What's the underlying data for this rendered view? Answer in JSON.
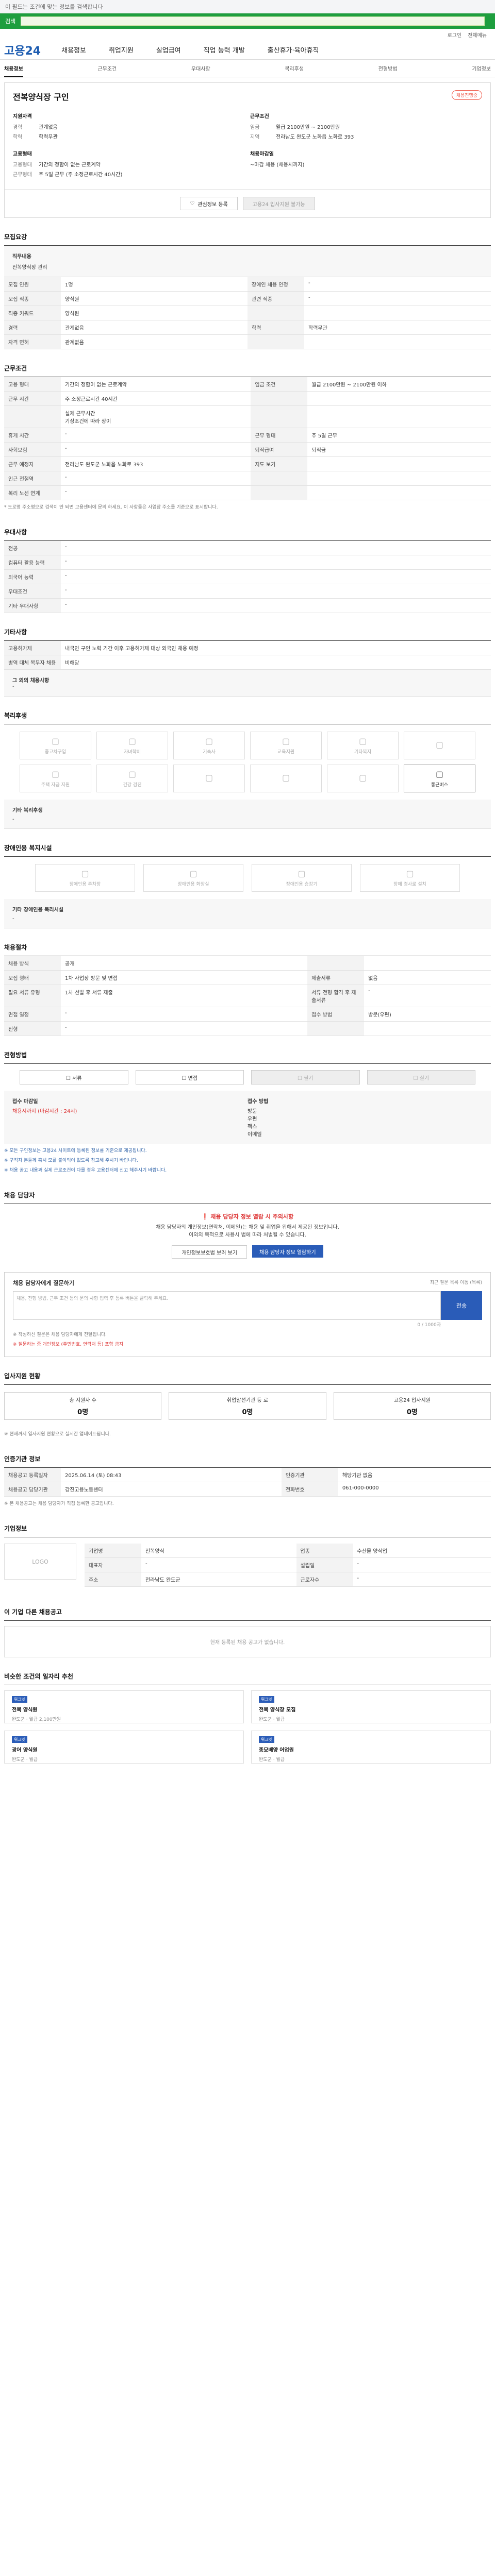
{
  "top": {
    "banner": "이 필드는 조건에 맞는 정보를 검색합니다",
    "search_label": "검색"
  },
  "util": {
    "login": "로그인",
    "sitemap": "전체메뉴"
  },
  "brand": {
    "logo": "고용24"
  },
  "gnb": [
    "채용정보",
    "취업지원",
    "실업급여",
    "직업 능력 개발",
    "출산휴가·육아휴직"
  ],
  "tabs": [
    "채용정보",
    "근무조건",
    "우대사항",
    "복리후생",
    "전형방법",
    "기업정보"
  ],
  "job": {
    "title": "전복양식장 구인",
    "status": "채용진행중",
    "company_h": "지원자격",
    "career_k": "경력",
    "career_v": "관계없음",
    "edu_k": "학력",
    "edu_v": "학력무관",
    "emp_h": "고용형태",
    "type_k": "고용형태",
    "type_v": "기간의 정함이 없는 근로계약",
    "time_k": "근무형태",
    "time_v": "주 5일 근무 (주 소정근로시간 40시간)",
    "cond_h": "근무조건",
    "pay_k": "임금",
    "pay_v": "월급 2100만원 ~ 2100만원",
    "loc_k": "지역",
    "loc_v": "전라남도 완도군 노화읍 노화로 393",
    "proc_h": "채용마감일",
    "proc_v": "~마감 채용 (채용시까지)",
    "save": "관심정보 등록",
    "apply": "고용24 입사지원 불가능"
  },
  "s1": {
    "title": "모집요강",
    "box_t": "직무내용",
    "box_v": "전복양식장 관리",
    "rows": [
      [
        "모집 인원",
        "1명",
        "장애인 채용 인정",
        "-"
      ],
      [
        "모집 직종",
        "양식원",
        "관련 직종",
        "-"
      ],
      [
        "직종 키워드",
        "양식원",
        "",
        ""
      ],
      [
        "경력",
        "관계없음",
        "학력",
        "학력무관"
      ],
      [
        "자격 면허",
        "관계없음",
        "",
        ""
      ]
    ]
  },
  "s2": {
    "title": "근무조건",
    "rows": [
      [
        "고용 형태",
        "기간의 정함이 없는 근로계약",
        "임금 조건",
        "월급 2100만원 ~ 2100만원 이하"
      ],
      [
        "근무 시간",
        "주 소정근로시간 40시간",
        "",
        ""
      ],
      [
        "",
        "실제 근무시간\n기상조건에 따라 상이",
        "",
        ""
      ],
      [
        "휴게 시간",
        "-",
        "근무 형태",
        "주 5일 근무"
      ],
      [
        "사회보험",
        "-",
        "퇴직급여",
        "퇴직금"
      ],
      [
        "근무 예정지",
        "전라남도 완도군 노화읍 노화로 393",
        "지도 보기",
        ""
      ],
      [
        "인근 전철역",
        "-",
        "",
        ""
      ],
      [
        "복리 노선 연계",
        "-",
        "",
        ""
      ]
    ],
    "note": "* 도로명 주소명으로 검색이 안 되면 고용센터에 문의 하세요. 이 사항들은 사업장 주소를 기준으로 표시합니다."
  },
  "s3": {
    "title": "우대사항",
    "rows": [
      [
        "전공",
        "-"
      ],
      [
        "컴퓨터 활용 능력",
        "-"
      ],
      [
        "외국어 능력",
        "-"
      ],
      [
        "우대조건",
        "-"
      ],
      [
        "기타 우대사항",
        "-"
      ]
    ]
  },
  "s4": {
    "title": "기타사항",
    "rows": [
      [
        "고용허가제",
        "내국인 구인 노력 기간 이후 고용허가제 대상 외국인 채용 예정"
      ],
      [
        "병역 대체 복무자 채용",
        "비해당"
      ]
    ],
    "box_t": "그 외의 채용사항",
    "box_v": "-"
  },
  "s5": {
    "title": "복리후생",
    "icons": [
      "중고차구입",
      "자녀학비",
      "기숙사",
      "교육지원",
      "기타복지",
      "",
      "주택 자금 지원",
      "건강 검진",
      "",
      "",
      "",
      "통근버스"
    ],
    "box_t": "기타 복리후생",
    "box_v": "-"
  },
  "s6": {
    "title": "장애인용 복지시설",
    "icons": [
      "장애인용 주차장",
      "장애인용 화장실",
      "장애인용 승강기",
      "장애 경사로 설치"
    ],
    "box_t": "기타 장애인용 복리시설",
    "box_v": "-"
  },
  "s7": {
    "title": "채용절차",
    "rows": [
      [
        "채용 방식",
        "공개",
        "",
        ""
      ],
      [
        "모집 형태",
        "1차 사업장 방문 및 면접",
        "제출서류",
        "없음"
      ],
      [
        "필요 서류 유형",
        "1차 선발 후 서류 제출",
        "서류 전형 합격 후 제출서류",
        "-"
      ],
      [
        "면접 일정",
        "-",
        "접수 방법",
        "방문(우편)"
      ],
      [
        "전형",
        "-",
        "",
        ""
      ]
    ]
  },
  "s8": {
    "title": "전형방법",
    "choices": [
      "서류",
      "면접",
      "필기",
      "실기"
    ],
    "step_l": "접수 마감일",
    "step_l_v": "채용시까지 (마감시간 : 24시)",
    "step_r": "접수 방법",
    "step_r_v": "방문\n우편\n팩스\n이메일",
    "notes": [
      "※ 모든 구인정보는 고용24 사이트에 등록된 정보를 기준으로 제공됩니다.",
      "※ 구직자 분들께 혹시 모를 불이익이 없도록 참고해 주시기 바랍니다.",
      "※ 채용 공고 내용과 실제 근로조건이 다를 경우 고용센터에 신고 해주시기 바랍니다."
    ]
  },
  "s9": {
    "title": "채용 담당자",
    "warn": "채용 담당자 정보 열람 시 주의사항",
    "p": "채용 담당자의 개인정보(연락처, 이메일)는 채용 및 취업을 위해서 제공된 정보입니다.\n이외의 목적으로 사용시 법에 따라 처벌될 수 있습니다.",
    "b1": "개인정보보호법 보러 보기",
    "b2": "채용 담당자 정보 열람하기"
  },
  "s10": {
    "title": "채용 담당자에게 질문하기",
    "hint": "최근 질문 목록 이동 (목록)",
    "placeholder": "채용, 전형 방법, 근무 조건 등의 문의 사항 입력 후 등록 버튼을 클릭해 주세요.",
    "count": "0 / 1000자",
    "send": "전송",
    "n1": "※ 작성하신 질문은 채용 담당자에게 전달됩니다.",
    "n2": "※ 질문하는 중 개인정보 (주민번호, 연락처 등) 포함 금지"
  },
  "s11": {
    "title": "입사지원 현황",
    "s": [
      [
        "총 지원자 수",
        "0명"
      ],
      [
        "취업알선기관 등 로",
        "0명"
      ],
      [
        "고용24 입사지원",
        "0명"
      ]
    ],
    "note": "※ 현재까지 입사지원 현황으로 실시간 업데이트됩니다."
  },
  "s12": {
    "title": "인증기관 정보",
    "rows": [
      [
        "채용공고 등록일자",
        "2025.06.14 (토) 08:43",
        "인증기관",
        "해당기관 없음"
      ],
      [
        "채용공고 담당기관",
        "강진고용노동센터",
        "전화번호",
        "061-000-0000"
      ]
    ],
    "note": "※ 본 채용공고는 채용 담당자가 직접 등록한 공고입니다."
  },
  "s13": {
    "title": "기업정보",
    "company": "전복양식장",
    "logo": "LOGO",
    "rows": [
      [
        "기업명",
        "전복양식",
        "업종",
        "수산물 양식업"
      ],
      [
        "대표자",
        "-",
        "설립일",
        "-"
      ],
      [
        "주소",
        "전라남도 완도군",
        "근로자수",
        "-"
      ]
    ]
  },
  "s14": {
    "title": "이 기업 다른 채용공고",
    "empty": "현재 등록된 채용 공고가 없습니다."
  },
  "s15": {
    "title": "비슷한 조건의 일자리 추천",
    "recs": [
      {
        "b": "워크넷",
        "t": "전복 양식원",
        "m": "완도군 · 월급 2,100만원"
      },
      {
        "b": "워크넷",
        "t": "전복 양식장 모집",
        "m": "완도군 · 월급"
      },
      {
        "b": "워크넷",
        "t": "광어 양식원",
        "m": "완도군 · 월급"
      },
      {
        "b": "워크넷",
        "t": "종묘배양 어업원",
        "m": "완도군 · 월급"
      }
    ]
  }
}
